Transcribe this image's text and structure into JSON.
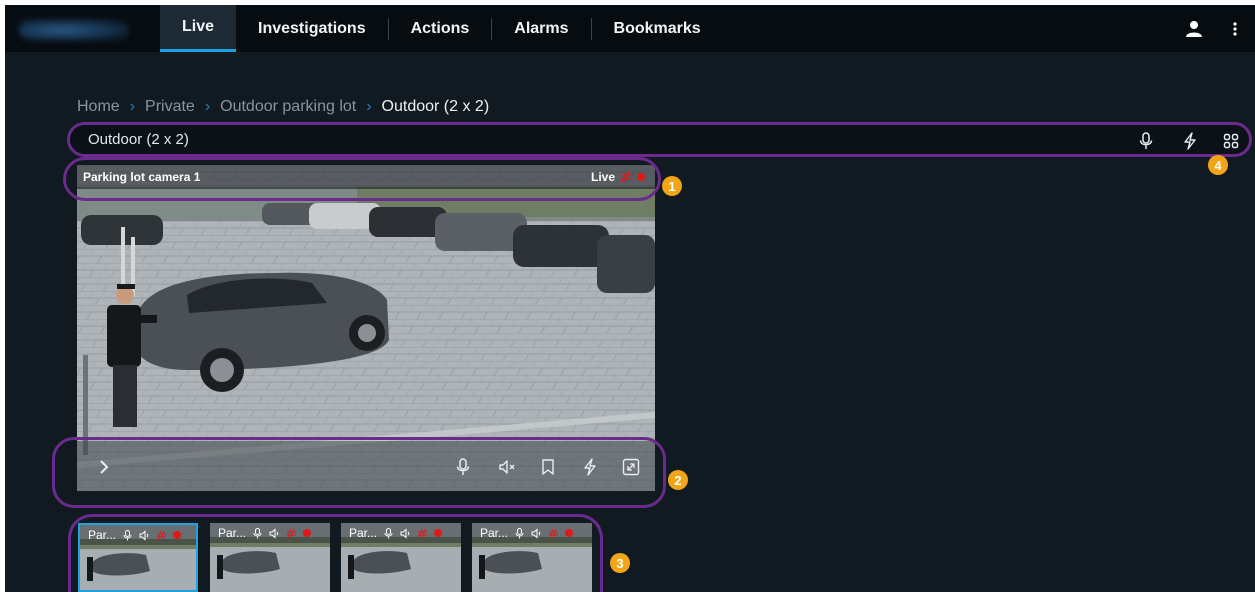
{
  "nav": {
    "tabs": [
      {
        "label": "Live",
        "active": true
      },
      {
        "label": "Investigations",
        "active": false
      },
      {
        "label": "Actions",
        "active": false
      },
      {
        "label": "Alarms",
        "active": false
      },
      {
        "label": "Bookmarks",
        "active": false
      }
    ],
    "user_icon": "user-icon",
    "menu_icon": "kebab-menu-icon"
  },
  "breadcrumb": [
    "Home",
    "Private",
    "Outdoor parking lot",
    "Outdoor (2 x 2)"
  ],
  "view": {
    "title": "Outdoor (2 x 2)",
    "icons": [
      "microphone-icon",
      "lightning-icon",
      "grid-layout-icon"
    ]
  },
  "camera": {
    "name": "Parking lot camera 1",
    "status": "Live",
    "status_icons": [
      "motion-icon",
      "recording-dot-icon"
    ],
    "controls": [
      "expand-chevron-icon",
      "microphone-icon",
      "speaker-muted-icon",
      "bookmark-icon",
      "lightning-icon",
      "fullscreen-icon"
    ]
  },
  "thumbnails": [
    {
      "label": "Par...",
      "selected": true
    },
    {
      "label": "Par...",
      "selected": false
    },
    {
      "label": "Par...",
      "selected": false
    },
    {
      "label": "Par...",
      "selected": false
    }
  ],
  "callouts": [
    "1",
    "2",
    "3",
    "4"
  ],
  "colors": {
    "background": "#111a21",
    "topbar": "#070c10",
    "accent": "#1fa0e0",
    "highlight": "#6a2b8c",
    "callout": "#f2a516",
    "recording": "#e01818"
  }
}
